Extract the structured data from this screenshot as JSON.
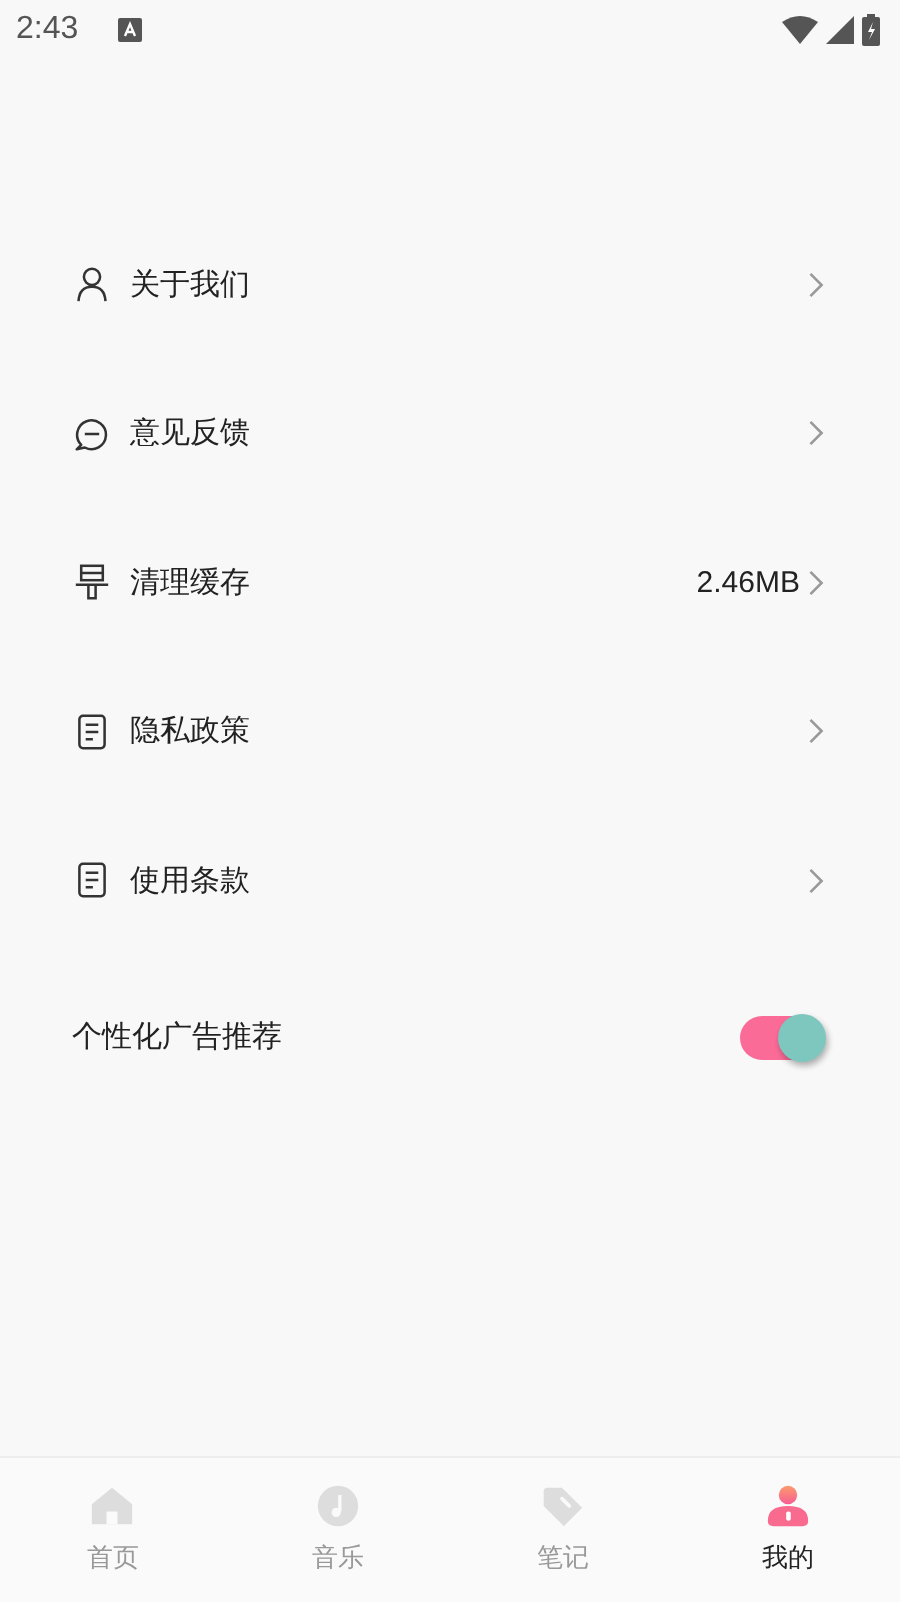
{
  "status_bar": {
    "time": "2:43"
  },
  "menu": [
    {
      "label": "关于我们"
    },
    {
      "label": "意见反馈"
    },
    {
      "label": "清理缓存",
      "value": "2.46MB"
    },
    {
      "label": "隐私政策"
    },
    {
      "label": "使用条款"
    }
  ],
  "ad_setting": {
    "label": "个性化广告推荐",
    "on": true
  },
  "tabs": [
    {
      "label": "首页",
      "selected": false
    },
    {
      "label": "音乐",
      "selected": false
    },
    {
      "label": "笔记",
      "selected": false
    },
    {
      "label": "我的",
      "selected": true
    }
  ]
}
